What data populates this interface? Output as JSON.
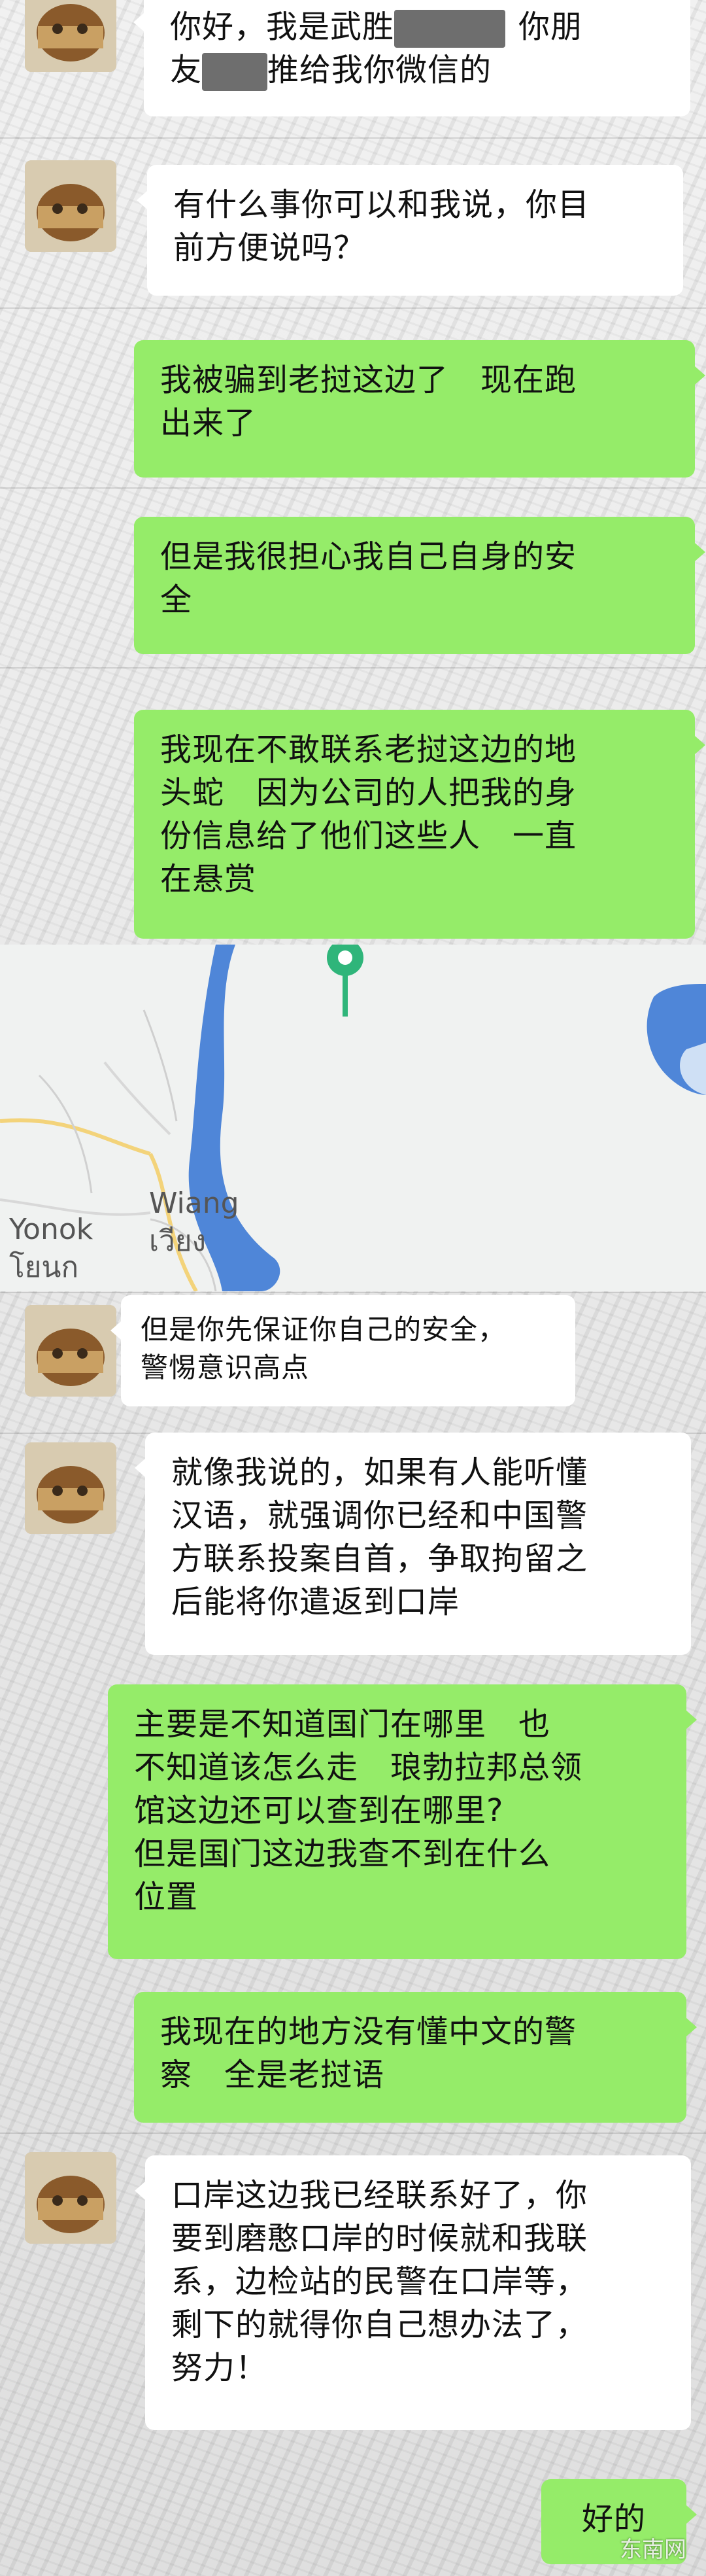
{
  "messages": [
    {
      "id": "m1",
      "side": "left",
      "parts": [
        "你好，我是武胜",
        "你朋",
        "友",
        "推给我你微信的"
      ]
    },
    {
      "id": "m2",
      "side": "left",
      "lines": [
        "有什么事你可以和我说，你目",
        "前方便说吗？"
      ]
    },
    {
      "id": "m3",
      "side": "right",
      "lines": [
        "我被骗到老挝这边了　现在跑",
        "出来了"
      ]
    },
    {
      "id": "m4",
      "side": "right",
      "lines": [
        "但是我很担心我自己自身的安",
        "全"
      ]
    },
    {
      "id": "m5",
      "side": "right",
      "lines": [
        "我现在不敢联系老挝这边的地",
        "头蛇　因为公司的人把我的身",
        "份信息给了他们这些人　一直",
        "在悬赏"
      ]
    },
    {
      "id": "m6",
      "side": "left",
      "lines": [
        "但是你先保证你自己的安全，",
        "警惕意识高点"
      ]
    },
    {
      "id": "m7",
      "side": "left",
      "lines": [
        "就像我说的，如果有人能听懂",
        "汉语，就强调你已经和中国警",
        "方联系投案自首，争取拘留之",
        "后能将你遣返到口岸"
      ]
    },
    {
      "id": "m8",
      "side": "right",
      "lines": [
        "主要是不知道国门在哪里　也",
        "不知道该怎么走　琅勃拉邦总领",
        "馆这边还可以查到在哪里?",
        "但是国门这边我查不到在什么",
        "位置"
      ]
    },
    {
      "id": "m9",
      "side": "right",
      "lines": [
        "我现在的地方没有懂中文的警",
        "察　全是老挝语"
      ]
    },
    {
      "id": "m10",
      "side": "left",
      "lines": [
        "口岸这边我已经联系好了，你",
        "要到磨憨口岸的时候就和我联",
        "系，边检站的民警在口岸等，",
        "剩下的就得你自己想办法了，",
        "努力！"
      ]
    },
    {
      "id": "m11",
      "side": "right",
      "lines": [
        "好的"
      ]
    }
  ],
  "map": {
    "labels": {
      "wiang_en": "Wiang",
      "wiang_th": "เวียง",
      "yonok_en": "Yonok",
      "yonok_th": "โยนก"
    },
    "pin_color": "#2fb57a",
    "water_color": "#4f86d8"
  },
  "colors": {
    "sent_bubble": "#95ec69",
    "received_bubble": "#ffffff"
  },
  "watermark": "东南网"
}
